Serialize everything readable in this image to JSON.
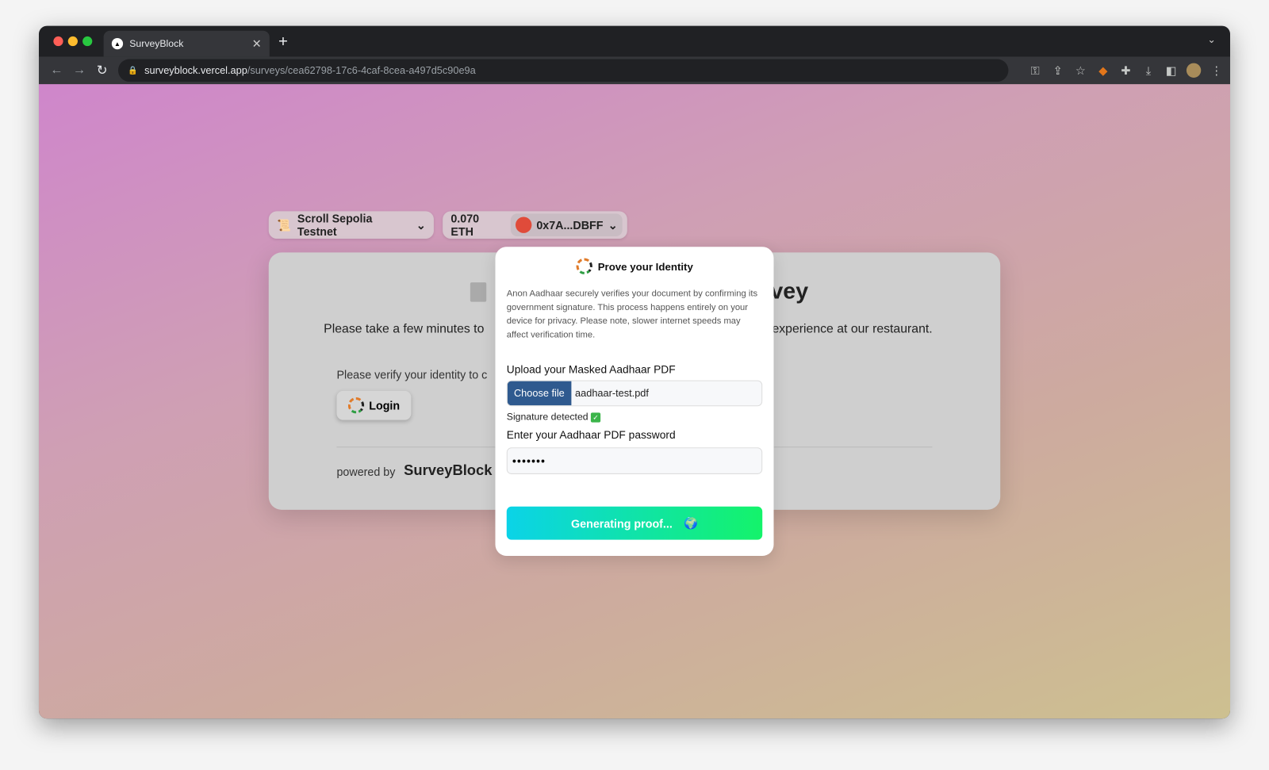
{
  "browser": {
    "tab_title": "SurveyBlock",
    "url_host": "surveyblock.vercel.app",
    "url_path": "/surveys/cea62798-17c6-4caf-8cea-a497d5c90e9a"
  },
  "wallet": {
    "network": "Scroll Sepolia Testnet",
    "balance": "0.070 ETH",
    "address": "0x7A...DBFF"
  },
  "survey": {
    "title_fragment": "vey",
    "description_left": "Please take a few minutes to",
    "description_right": "experience at our restaurant.",
    "verify_text": "Please verify your identity to c",
    "login_label": "Login",
    "powered_by": "powered by",
    "brand": "SurveyBlock"
  },
  "modal": {
    "title": "Prove your Identity",
    "description": "Anon Aadhaar securely verifies your document by confirming its government signature. This process happens entirely on your device for privacy. Please note, slower internet speeds may affect verification time.",
    "upload_label": "Upload your Masked Aadhaar PDF",
    "choose_file": "Choose file",
    "file_name": "aadhaar-test.pdf",
    "signature_status": "Signature detected",
    "password_label": "Enter your Aadhaar PDF password",
    "password_value": "•••••••",
    "generate_label": "Generating proof..."
  }
}
